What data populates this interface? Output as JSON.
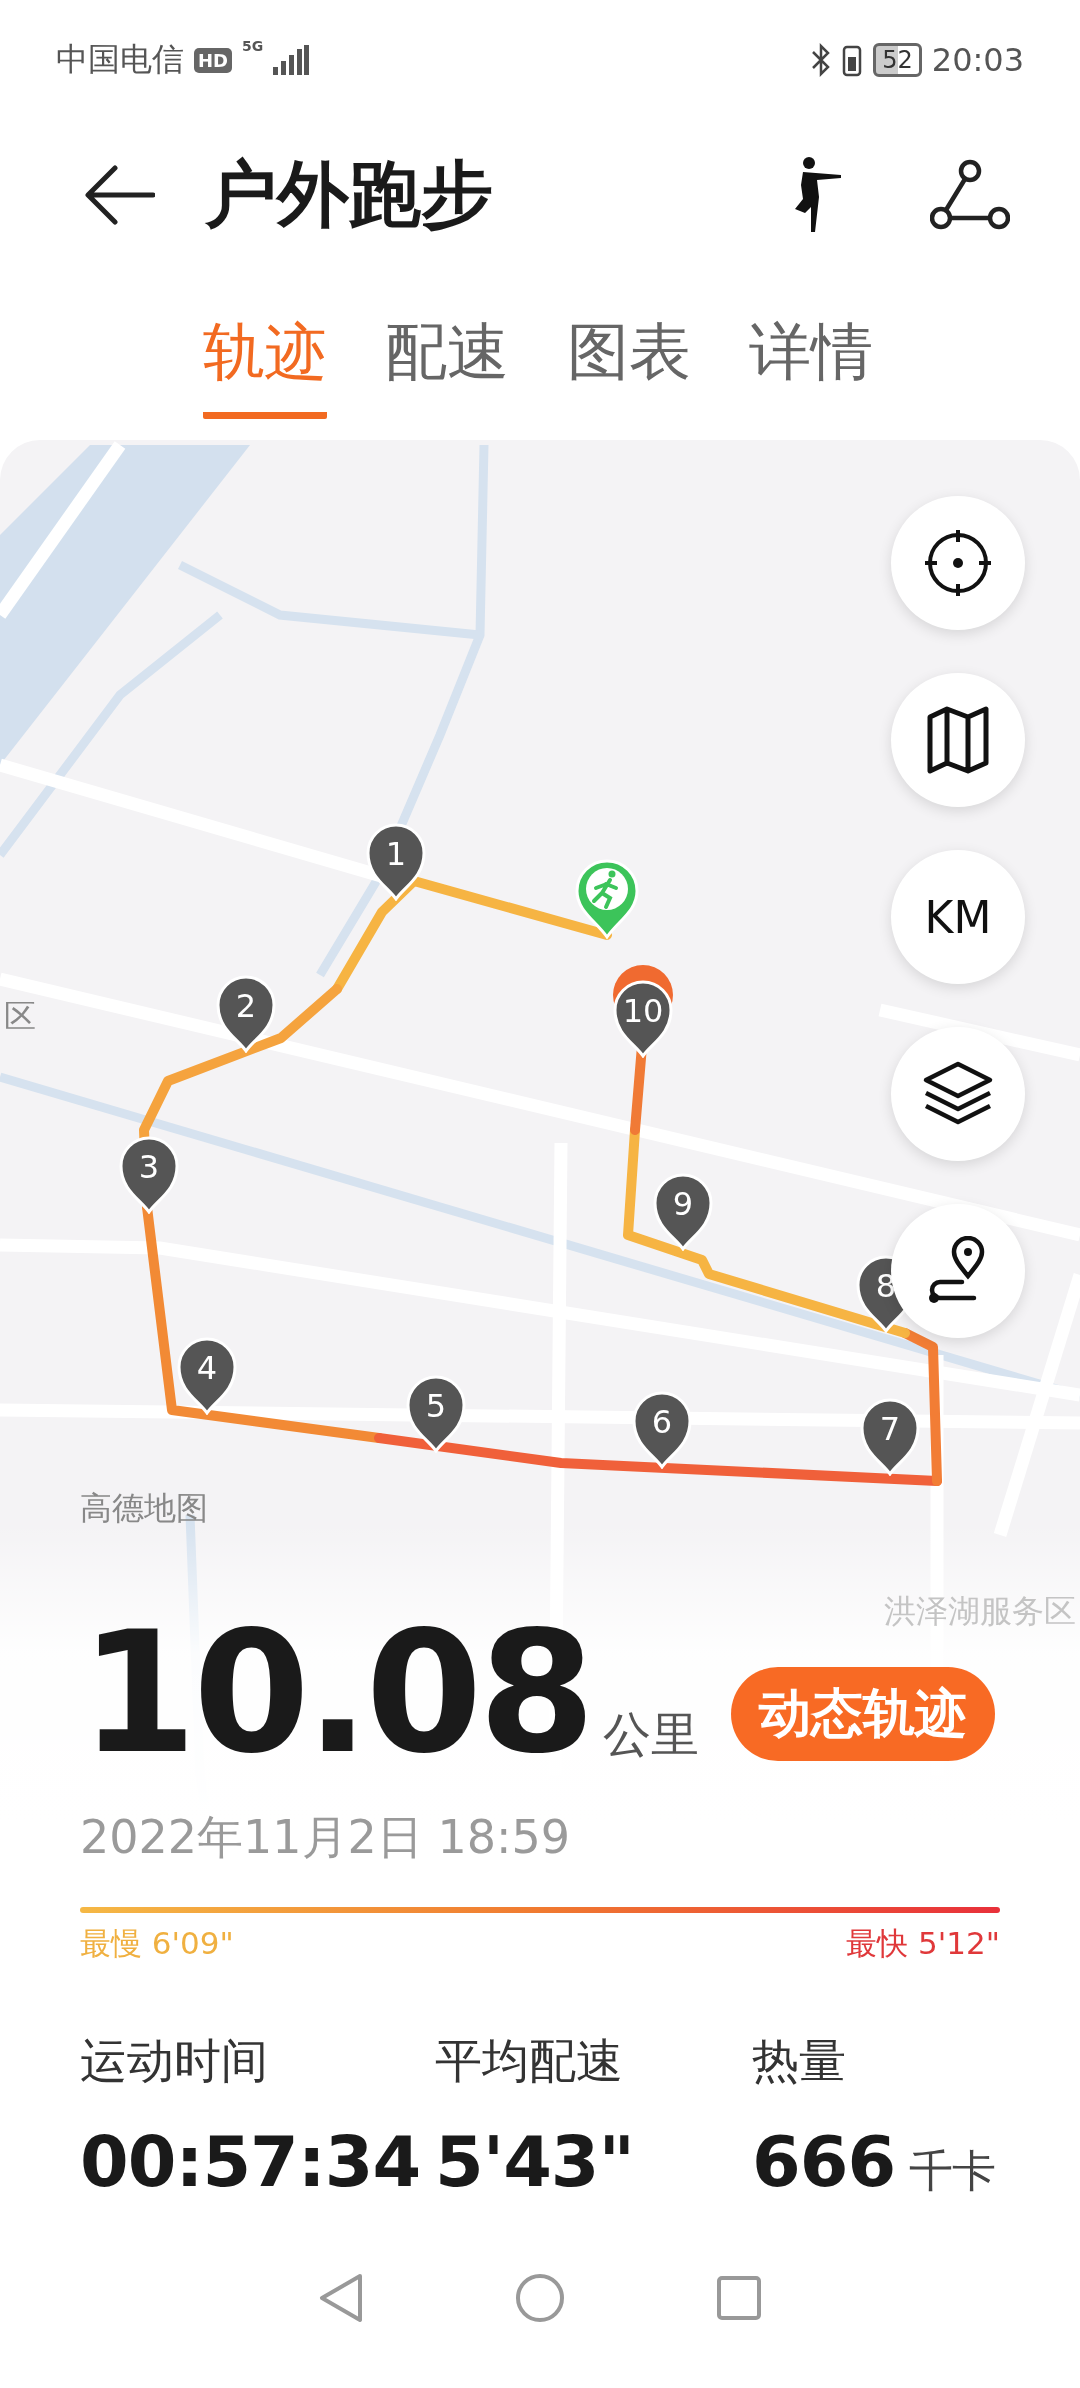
{
  "status_bar": {
    "carrier": "中国电信",
    "network_badge": "HD",
    "network": "5G",
    "battery": "52",
    "time": "20:03"
  },
  "header": {
    "title": "户外跑步"
  },
  "tabs": [
    {
      "label": "轨迹",
      "selected": true
    },
    {
      "label": "配速",
      "selected": false
    },
    {
      "label": "图表",
      "selected": false
    },
    {
      "label": "详情",
      "selected": false
    }
  ],
  "map": {
    "labels": [
      "区",
      "高德地图",
      "洪泽湖服务区"
    ],
    "markers": [
      "1",
      "2",
      "3",
      "4",
      "5",
      "6",
      "7",
      "8",
      "9",
      "10"
    ],
    "controls": [
      {
        "kind": "locate"
      },
      {
        "kind": "map"
      },
      {
        "kind": "unit",
        "label": "KM"
      },
      {
        "kind": "layers"
      },
      {
        "kind": "route"
      }
    ]
  },
  "summary": {
    "distance": "10.08",
    "unit": "公里",
    "replay_button": "动态轨迹",
    "date": "2022年11月2日 18:59",
    "slowest": "最慢 6'09\"",
    "fastest": "最快 5'12\""
  },
  "stats": [
    {
      "label": "运动时间",
      "value": "00:57:34"
    },
    {
      "label": "平均配速",
      "value": "5'43\""
    },
    {
      "label": "热量",
      "value": "666",
      "unit": "千卡"
    }
  ]
}
